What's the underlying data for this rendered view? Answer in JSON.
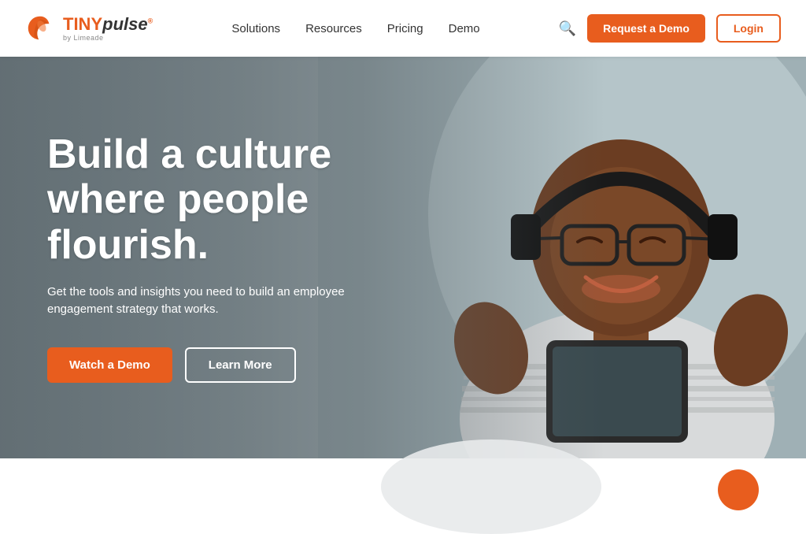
{
  "brand": {
    "name_tiny": "TINY",
    "name_pulse": "pulse",
    "tagline": "by Limeade"
  },
  "nav": {
    "links": [
      {
        "label": "Solutions",
        "id": "solutions"
      },
      {
        "label": "Resources",
        "id": "resources"
      },
      {
        "label": "Pricing",
        "id": "pricing"
      },
      {
        "label": "Demo",
        "id": "demo"
      }
    ],
    "request_demo": "Request a Demo",
    "login": "Login"
  },
  "hero": {
    "headline": "Build a culture where people flourish.",
    "subtext": "Get the tools and insights you need to build an employee engagement strategy that works.",
    "btn_watch": "Watch a Demo",
    "btn_learn": "Learn More"
  },
  "icons": {
    "search": "🔍"
  }
}
